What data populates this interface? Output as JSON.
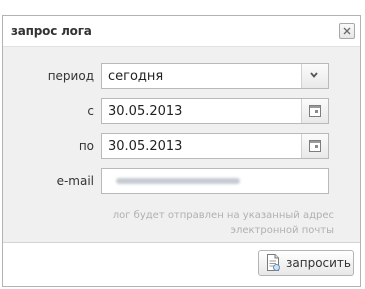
{
  "dialog": {
    "title": "запрос лога",
    "close_icon": "close-icon"
  },
  "form": {
    "period": {
      "label": "период",
      "value": "сегодня",
      "icon": "chevron-down-icon"
    },
    "from": {
      "label": "с",
      "value": "30.05.2013",
      "icon": "calendar-icon"
    },
    "to": {
      "label": "по",
      "value": "30.05.2013",
      "icon": "calendar-icon"
    },
    "email": {
      "label": "e-mail"
    },
    "note": "лог будет отправлен на указанный адрес электронной почты"
  },
  "footer": {
    "submit_label": "запросить",
    "submit_icon": "document-icon"
  }
}
